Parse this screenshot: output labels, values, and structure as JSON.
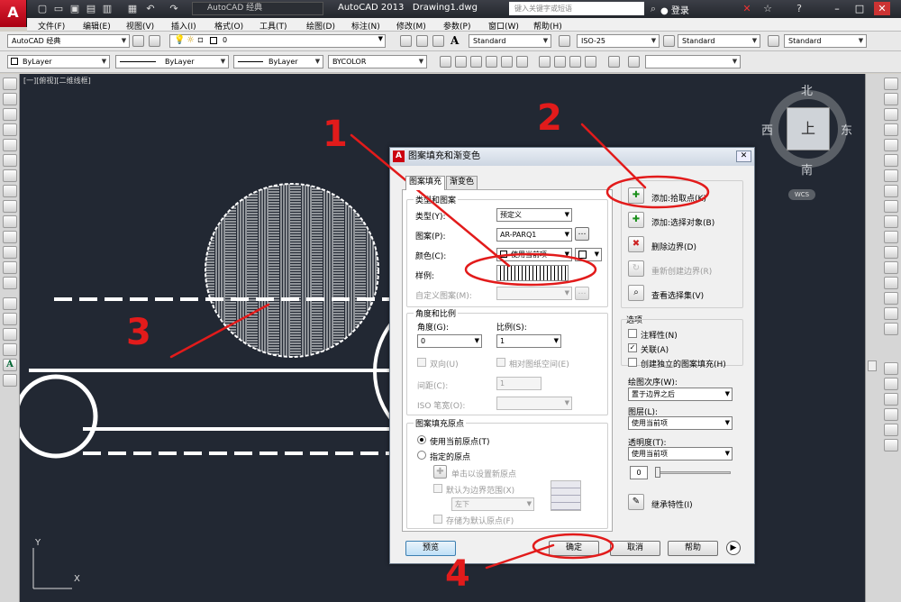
{
  "titlebar": {
    "logo": "A",
    "workspace": "AutoCAD 经典",
    "app_doc": "AutoCAD 2013",
    "doc": "Drawing1.dwg",
    "search_placeholder": "键入关键字或短语",
    "login": "登录"
  },
  "menubar": [
    "文件(F)",
    "编辑(E)",
    "视图(V)",
    "插入(I)",
    "格式(O)",
    "工具(T)",
    "绘图(D)",
    "标注(N)",
    "修改(M)",
    "参数(P)",
    "窗口(W)",
    "帮助(H)"
  ],
  "toolbar": {
    "workspace": "AutoCAD 经典",
    "layer": "0",
    "text_style": "Standard",
    "dim_style": "ISO-25",
    "table_style": "Standard",
    "mleader_style": "Standard",
    "color": "ByLayer",
    "linetype": "ByLayer",
    "lineweight": "ByLayer",
    "plotstyle": "BYCOLOR"
  },
  "canvas": {
    "view_label": "[一][俯视][二维线框]",
    "ucs_y": "Y",
    "ucs_x": "X"
  },
  "viewcube": {
    "north": "北",
    "south": "南",
    "west": "西",
    "east": "东",
    "top": "上",
    "wcs": "WCS"
  },
  "dialog": {
    "title": "图案填充和渐变色",
    "tabs": [
      "图案填充",
      "渐变色"
    ],
    "type_pattern_group": "类型和图案",
    "type_label": "类型(Y):",
    "type_value": "预定义",
    "pattern_label": "图案(P):",
    "pattern_value": "AR-PARQ1",
    "color_label": "颜色(C):",
    "color_value": "使用当前项",
    "swatch_label": "样例:",
    "custom_pattern_label": "自定义图案(M):",
    "angle_scale_group": "角度和比例",
    "angle_label": "角度(G):",
    "angle_value": "0",
    "scale_label": "比例(S):",
    "scale_value": "1",
    "double_label": "双向(U)",
    "relative_label": "相对图纸空间(E)",
    "spacing_label": "间距(C):",
    "spacing_value": "1",
    "iso_label": "ISO 笔宽(O):",
    "origin_group": "图案填充原点",
    "use_current_origin": "使用当前原点(T)",
    "specified_origin": "指定的原点",
    "click_set_origin": "单击以设置新原点",
    "default_boundary": "默认为边界范围(X)",
    "boundary_pos": "左下",
    "store_default": "存储为默认原点(F)",
    "boundary_group": "边界",
    "add_pick": "添加:拾取点(K)",
    "add_select": "添加:选择对象(B)",
    "remove_boundary": "删除边界(D)",
    "recreate_boundary": "重新创建边界(R)",
    "view_selection": "查看选择集(V)",
    "options_group": "选项",
    "annotative": "注释性(N)",
    "associative": "关联(A)",
    "separate": "创建独立的图案填充(H)",
    "draw_order_label": "绘图次序(W):",
    "draw_order_value": "置于边界之后",
    "layer_label": "图层(L):",
    "layer_value": "使用当前项",
    "transparency_label": "透明度(T):",
    "transparency_value": "使用当前项",
    "transparency_amount": "0",
    "inherit": "继承特性(I)",
    "preview_btn": "预览",
    "ok_btn": "确定",
    "cancel_btn": "取消",
    "help_btn": "帮助"
  },
  "annotations": [
    "1",
    "2",
    "3",
    "4"
  ],
  "colors": {
    "canvas": "#222833",
    "annotation": "#e21b1b",
    "titlebar": "#2b2e34"
  }
}
